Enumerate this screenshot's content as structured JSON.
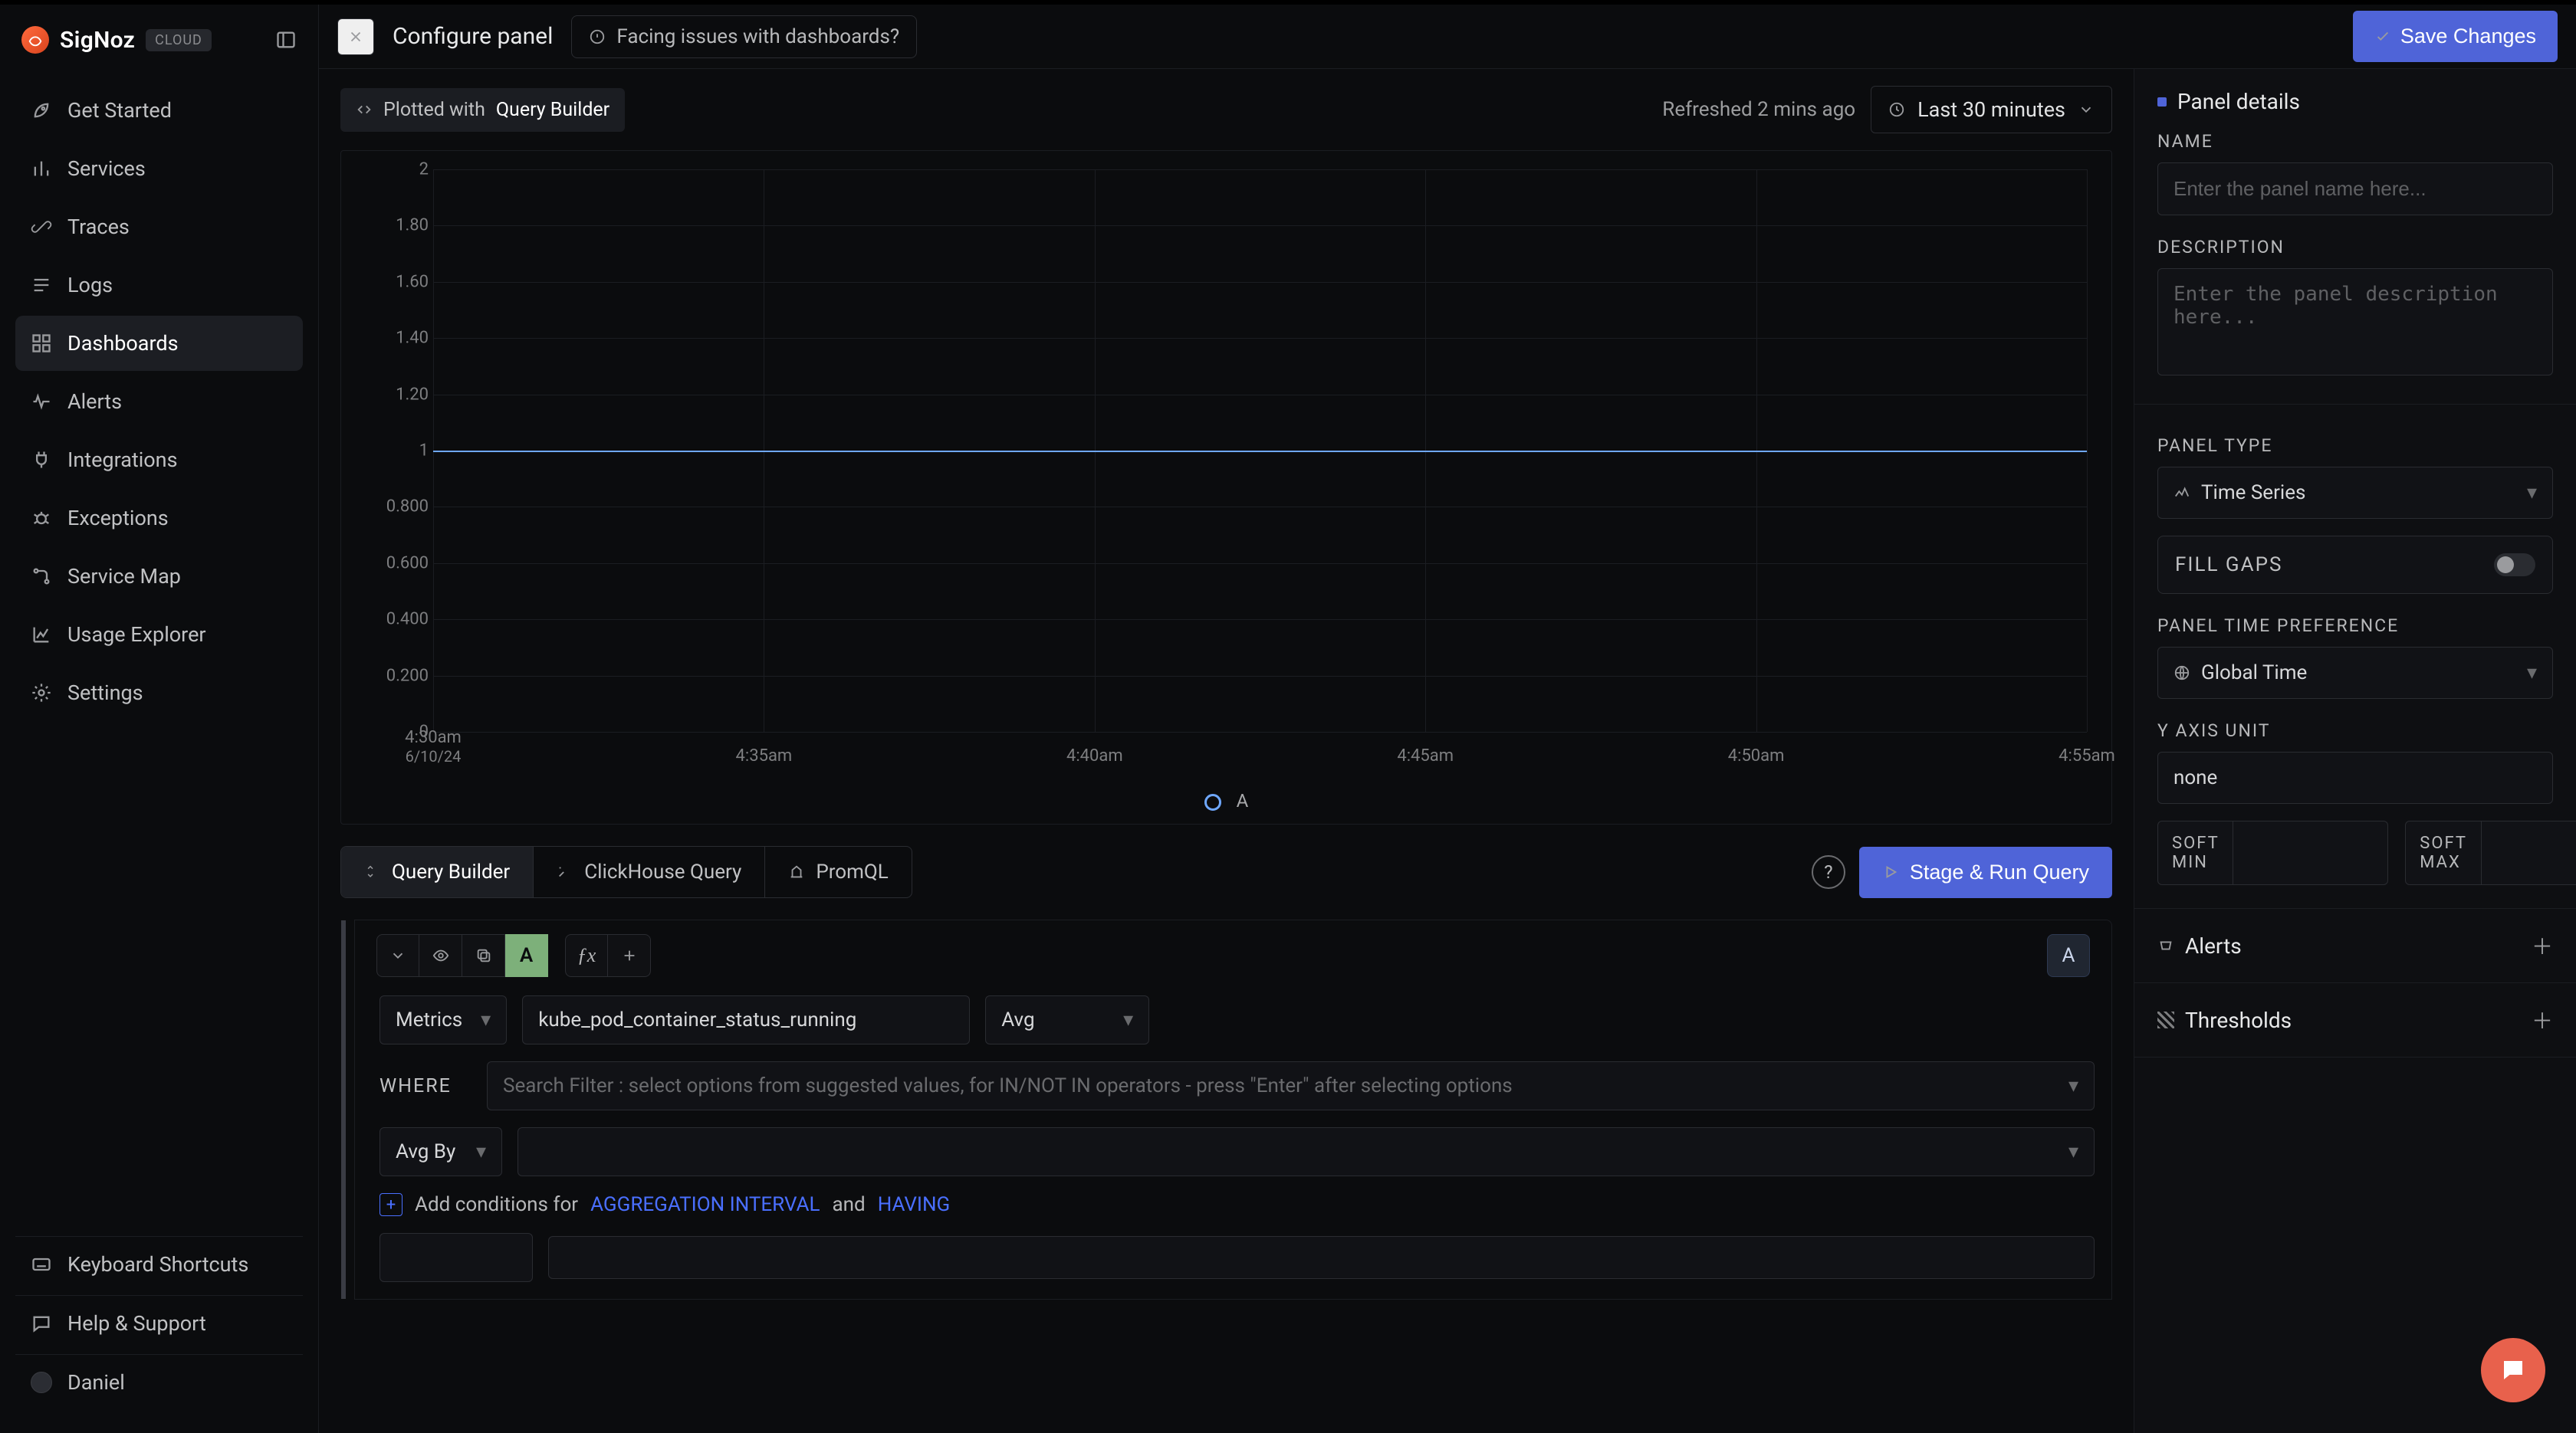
{
  "brand": {
    "name": "SigNoz",
    "pill": "CLOUD"
  },
  "sidebar": {
    "items": [
      {
        "label": "Get Started",
        "icon": "rocket-icon"
      },
      {
        "label": "Services",
        "icon": "bars-icon"
      },
      {
        "label": "Traces",
        "icon": "link-icon"
      },
      {
        "label": "Logs",
        "icon": "logs-icon"
      },
      {
        "label": "Dashboards",
        "icon": "grid-icon",
        "active": true
      },
      {
        "label": "Alerts",
        "icon": "wave-icon"
      },
      {
        "label": "Integrations",
        "icon": "plug-icon"
      },
      {
        "label": "Exceptions",
        "icon": "bug-icon"
      },
      {
        "label": "Service Map",
        "icon": "route-icon"
      },
      {
        "label": "Usage Explorer",
        "icon": "chart-icon"
      },
      {
        "label": "Settings",
        "icon": "gear-icon"
      }
    ],
    "bottom": [
      {
        "label": "Keyboard Shortcuts",
        "icon": "keyboard-icon"
      },
      {
        "label": "Help & Support",
        "icon": "chat-icon"
      },
      {
        "label": "Daniel",
        "icon": "avatar-icon"
      }
    ]
  },
  "topbar": {
    "title": "Configure panel",
    "issues_label": "Facing issues with dashboards?",
    "save_label": "Save Changes"
  },
  "preview": {
    "plotted_prefix": "Plotted with ",
    "plotted_method": "Query Builder",
    "refreshed": "Refreshed 2 mins ago",
    "time_range": "Last 30 minutes",
    "legend_label": "A"
  },
  "chart_data": {
    "type": "line",
    "title": "",
    "xlabel": "",
    "ylabel": "",
    "ylim": [
      0,
      2
    ],
    "y_ticks": [
      "2",
      "1.80",
      "1.60",
      "1.40",
      "1.20",
      "1",
      "0.800",
      "0.600",
      "0.400",
      "0.200",
      "0"
    ],
    "x_ticks": [
      {
        "t": "4:30am",
        "sub": "6/10/24"
      },
      {
        "t": "4:35am"
      },
      {
        "t": "4:40am"
      },
      {
        "t": "4:45am"
      },
      {
        "t": "4:50am"
      },
      {
        "t": "4:55am"
      }
    ],
    "series": [
      {
        "name": "A",
        "color": "#6fa8ff",
        "x": [
          "4:30am",
          "4:35am",
          "4:40am",
          "4:45am",
          "4:50am",
          "4:55am"
        ],
        "values": [
          1,
          1,
          1,
          1,
          1,
          1
        ]
      }
    ]
  },
  "tabs": {
    "query_builder": "Query Builder",
    "clickhouse": "ClickHouse Query",
    "promql": "PromQL",
    "stage_run": "Stage & Run Query"
  },
  "query": {
    "letter": "A",
    "badge_letter": "A",
    "source_type": "Metrics",
    "metric": "kube_pod_container_status_running",
    "agg": "Avg",
    "where_label": "WHERE",
    "where_placeholder": "Search Filter : select options from suggested values, for IN/NOT IN operators - press \"Enter\" after selecting options",
    "group_by": "Avg By",
    "add_prefix": "Add conditions for ",
    "add_link1": "AGGREGATION INTERVAL",
    "add_mid": " and ",
    "add_link2": "HAVING"
  },
  "panel": {
    "details_title": "Panel details",
    "name_label": "NAME",
    "name_placeholder": "Enter the panel name here...",
    "desc_label": "DESCRIPTION",
    "desc_placeholder": "Enter the panel description here...",
    "type_label": "PANEL TYPE",
    "type_value": "Time Series",
    "fill_gaps_label": "FILL GAPS",
    "time_pref_label": "PANEL TIME PREFERENCE",
    "time_pref_value": "Global Time",
    "y_unit_label": "Y AXIS UNIT",
    "y_unit_value": "none",
    "soft_min_label": "SOFT MIN",
    "soft_max_label": "SOFT MAX",
    "alerts_title": "Alerts",
    "thresholds_title": "Thresholds"
  }
}
